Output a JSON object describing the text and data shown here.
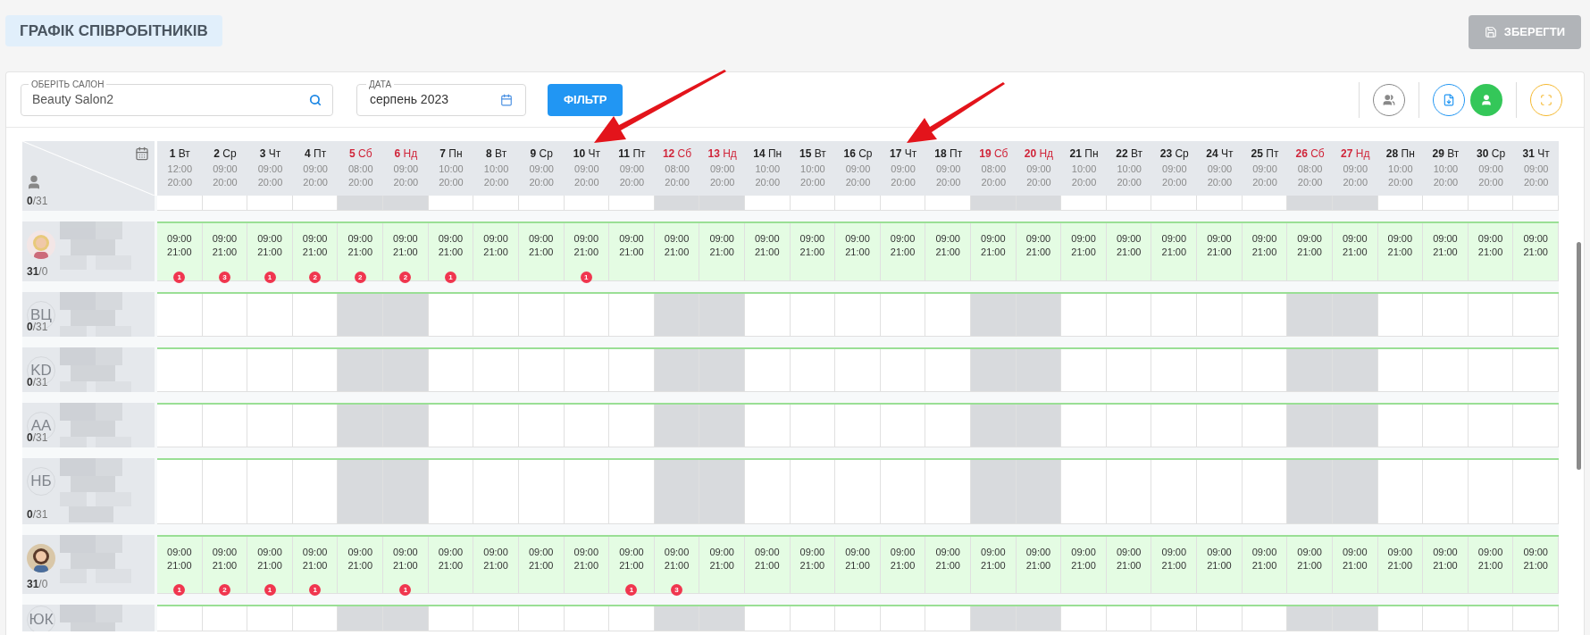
{
  "page": {
    "title": "ГРАФІК СПІВРОБІТНИКІВ",
    "save_button": "ЗБЕРЕГТИ"
  },
  "filters": {
    "salon": {
      "label": "ОБЕРІТЬ САЛОН",
      "value": "Beauty Salon2"
    },
    "date": {
      "label": "ДАТА",
      "value": "серпень 2023"
    },
    "filter_button": "ФІЛЬТР"
  },
  "days": [
    {
      "day": "1",
      "weekday": "Вт",
      "weekend": false,
      "open": "12:00",
      "close": "20:00"
    },
    {
      "day": "2",
      "weekday": "Ср",
      "weekend": false,
      "open": "09:00",
      "close": "20:00"
    },
    {
      "day": "3",
      "weekday": "Чт",
      "weekend": false,
      "open": "09:00",
      "close": "20:00"
    },
    {
      "day": "4",
      "weekday": "Пт",
      "weekend": false,
      "open": "09:00",
      "close": "20:00"
    },
    {
      "day": "5",
      "weekday": "Сб",
      "weekend": true,
      "open": "08:00",
      "close": "20:00"
    },
    {
      "day": "6",
      "weekday": "Нд",
      "weekend": true,
      "open": "09:00",
      "close": "20:00"
    },
    {
      "day": "7",
      "weekday": "Пн",
      "weekend": false,
      "open": "10:00",
      "close": "20:00"
    },
    {
      "day": "8",
      "weekday": "Вт",
      "weekend": false,
      "open": "10:00",
      "close": "20:00"
    },
    {
      "day": "9",
      "weekday": "Ср",
      "weekend": false,
      "open": "09:00",
      "close": "20:00"
    },
    {
      "day": "10",
      "weekday": "Чт",
      "weekend": false,
      "open": "09:00",
      "close": "20:00"
    },
    {
      "day": "11",
      "weekday": "Пт",
      "weekend": false,
      "open": "09:00",
      "close": "20:00"
    },
    {
      "day": "12",
      "weekday": "Сб",
      "weekend": true,
      "open": "08:00",
      "close": "20:00"
    },
    {
      "day": "13",
      "weekday": "Нд",
      "weekend": true,
      "open": "09:00",
      "close": "20:00"
    },
    {
      "day": "14",
      "weekday": "Пн",
      "weekend": false,
      "open": "10:00",
      "close": "20:00"
    },
    {
      "day": "15",
      "weekday": "Вт",
      "weekend": false,
      "open": "10:00",
      "close": "20:00"
    },
    {
      "day": "16",
      "weekday": "Ср",
      "weekend": false,
      "open": "09:00",
      "close": "20:00"
    },
    {
      "day": "17",
      "weekday": "Чт",
      "weekend": false,
      "open": "09:00",
      "close": "20:00"
    },
    {
      "day": "18",
      "weekday": "Пт",
      "weekend": false,
      "open": "09:00",
      "close": "20:00"
    },
    {
      "day": "19",
      "weekday": "Сб",
      "weekend": true,
      "open": "08:00",
      "close": "20:00"
    },
    {
      "day": "20",
      "weekday": "Нд",
      "weekend": true,
      "open": "09:00",
      "close": "20:00"
    },
    {
      "day": "21",
      "weekday": "Пн",
      "weekend": false,
      "open": "10:00",
      "close": "20:00"
    },
    {
      "day": "22",
      "weekday": "Вт",
      "weekend": false,
      "open": "10:00",
      "close": "20:00"
    },
    {
      "day": "23",
      "weekday": "Ср",
      "weekend": false,
      "open": "09:00",
      "close": "20:00"
    },
    {
      "day": "24",
      "weekday": "Чт",
      "weekend": false,
      "open": "09:00",
      "close": "20:00"
    },
    {
      "day": "25",
      "weekday": "Пт",
      "weekend": false,
      "open": "09:00",
      "close": "20:00"
    },
    {
      "day": "26",
      "weekday": "Сб",
      "weekend": true,
      "open": "08:00",
      "close": "20:00"
    },
    {
      "day": "27",
      "weekday": "Нд",
      "weekend": true,
      "open": "09:00",
      "close": "20:00"
    },
    {
      "day": "28",
      "weekday": "Пн",
      "weekend": false,
      "open": "10:00",
      "close": "20:00"
    },
    {
      "day": "29",
      "weekday": "Вт",
      "weekend": false,
      "open": "10:00",
      "close": "20:00"
    },
    {
      "day": "30",
      "weekday": "Ср",
      "weekend": false,
      "open": "09:00",
      "close": "20:00"
    },
    {
      "day": "31",
      "weekday": "Чт",
      "weekend": false,
      "open": "09:00",
      "close": "20:00"
    }
  ],
  "employees": [
    {
      "kind": "partial",
      "count": "**0**/31"
    },
    {
      "count": "**31**/0",
      "shifts": [
        {
          "start": "09:00",
          "end": "21:00",
          "badge": "1"
        },
        {
          "start": "09:00",
          "end": "21:00",
          "badge": "3"
        },
        {
          "start": "09:00",
          "end": "21:00",
          "badge": "1"
        },
        {
          "start": "09:00",
          "end": "21:00",
          "badge": "2"
        },
        {
          "start": "09:00",
          "end": "21:00",
          "badge": "2"
        },
        {
          "start": "09:00",
          "end": "21:00",
          "badge": "2"
        },
        {
          "start": "09:00",
          "end": "21:00",
          "badge": "1"
        },
        {
          "start": "09:00",
          "end": "21:00"
        },
        {
          "start": "09:00",
          "end": "21:00"
        },
        {
          "start": "09:00",
          "end": "21:00",
          "badge": "1"
        },
        {
          "start": "09:00",
          "end": "21:00"
        },
        {
          "start": "09:00",
          "end": "21:00"
        },
        {
          "start": "09:00",
          "end": "21:00"
        },
        {
          "start": "09:00",
          "end": "21:00"
        },
        {
          "start": "09:00",
          "end": "21:00"
        },
        {
          "start": "09:00",
          "end": "21:00"
        },
        {
          "start": "09:00",
          "end": "21:00"
        },
        {
          "start": "09:00",
          "end": "21:00"
        },
        {
          "start": "09:00",
          "end": "21:00"
        },
        {
          "start": "09:00",
          "end": "21:00"
        },
        {
          "start": "09:00",
          "end": "21:00"
        },
        {
          "start": "09:00",
          "end": "21:00"
        },
        {
          "start": "09:00",
          "end": "21:00"
        },
        {
          "start": "09:00",
          "end": "21:00"
        },
        {
          "start": "09:00",
          "end": "21:00"
        },
        {
          "start": "09:00",
          "end": "21:00"
        },
        {
          "start": "09:00",
          "end": "21:00"
        },
        {
          "start": "09:00",
          "end": "21:00"
        },
        {
          "start": "09:00",
          "end": "21:00"
        },
        {
          "start": "09:00",
          "end": "21:00"
        },
        {
          "start": "09:00",
          "end": "21:00"
        }
      ]
    },
    {
      "kind": "initials",
      "initials": "ВЦ",
      "count": "**0**/31"
    },
    {
      "kind": "initials",
      "initials": "KD",
      "count": "**0**/31"
    },
    {
      "kind": "initials",
      "initials": "AA",
      "count": "**0**/31"
    },
    {
      "kind": "initials",
      "initials": "НБ",
      "count": "**0**/31"
    },
    {
      "count": "**31**/0",
      "shifts": [
        {
          "start": "09:00",
          "end": "21:00",
          "badge": "1"
        },
        {
          "start": "09:00",
          "end": "21:00",
          "badge": "2"
        },
        {
          "start": "09:00",
          "end": "21:00",
          "badge": "1"
        },
        {
          "start": "09:00",
          "end": "21:00",
          "badge": "1"
        },
        {
          "start": "09:00",
          "end": "21:00"
        },
        {
          "start": "09:00",
          "end": "21:00",
          "badge": "1"
        },
        {
          "start": "09:00",
          "end": "21:00"
        },
        {
          "start": "09:00",
          "end": "21:00"
        },
        {
          "start": "09:00",
          "end": "21:00"
        },
        {
          "start": "09:00",
          "end": "21:00"
        },
        {
          "start": "09:00",
          "end": "21:00",
          "badge": "1"
        },
        {
          "start": "09:00",
          "end": "21:00",
          "badge": "3"
        },
        {
          "start": "09:00",
          "end": "21:00"
        },
        {
          "start": "09:00",
          "end": "21:00"
        },
        {
          "start": "09:00",
          "end": "21:00"
        },
        {
          "start": "09:00",
          "end": "21:00"
        },
        {
          "start": "09:00",
          "end": "21:00"
        },
        {
          "start": "09:00",
          "end": "21:00"
        },
        {
          "start": "09:00",
          "end": "21:00"
        },
        {
          "start": "09:00",
          "end": "21:00"
        },
        {
          "start": "09:00",
          "end": "21:00"
        },
        {
          "start": "09:00",
          "end": "21:00"
        },
        {
          "start": "09:00",
          "end": "21:00"
        },
        {
          "start": "09:00",
          "end": "21:00"
        },
        {
          "start": "09:00",
          "end": "21:00"
        },
        {
          "start": "09:00",
          "end": "21:00"
        },
        {
          "start": "09:00",
          "end": "21:00"
        },
        {
          "start": "09:00",
          "end": "21:00"
        },
        {
          "start": "09:00",
          "end": "21:00"
        },
        {
          "start": "09:00",
          "end": "21:00"
        },
        {
          "start": "09:00",
          "end": "21:00"
        }
      ]
    },
    {
      "kind": "initials",
      "initials": "ЮК"
    }
  ]
}
